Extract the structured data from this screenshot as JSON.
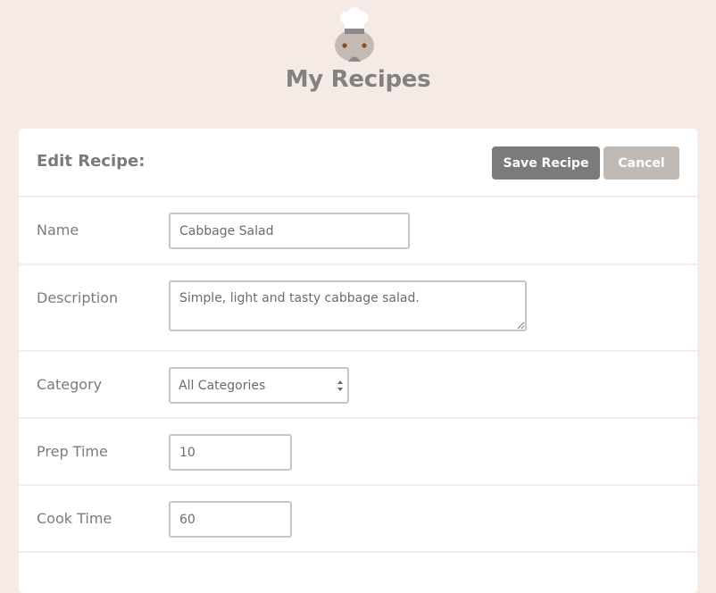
{
  "app": {
    "title": "My Recipes",
    "logo_icon": "chef-icon"
  },
  "editor": {
    "title": "Edit Recipe:",
    "save_label": "Save Recipe",
    "cancel_label": "Cancel"
  },
  "fields": {
    "name": {
      "label": "Name",
      "value": "Cabbage Salad"
    },
    "description": {
      "label": "Description",
      "value": "Simple, light and tasty cabbage salad."
    },
    "category": {
      "label": "Category",
      "value": "All Categories"
    },
    "prep_time": {
      "label": "Prep Time",
      "value": "10"
    },
    "cook_time": {
      "label": "Cook Time",
      "value": "60"
    }
  },
  "colors": {
    "page_bg": "#f5eae6",
    "save_button": "#7b7b7b",
    "cancel_button": "#c0b9b4"
  }
}
